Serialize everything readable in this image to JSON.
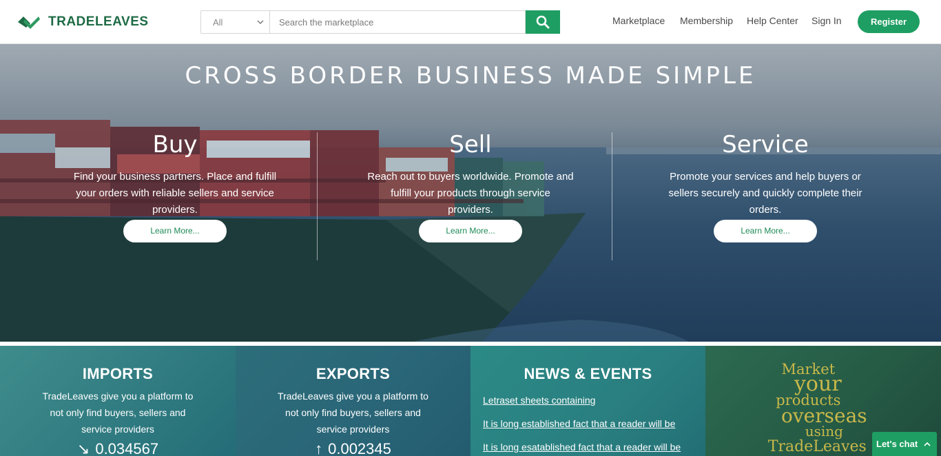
{
  "brand": {
    "name": "TRADELEAVES",
    "color": "#1e6b45",
    "accent": "#1e9e62"
  },
  "search": {
    "category": "All",
    "placeholder": "Search the marketplace"
  },
  "nav": {
    "items": [
      "Marketplace",
      "Membership",
      "Help Center",
      "Sign In"
    ],
    "register_label": "Register"
  },
  "hero": {
    "title": "CROSS BORDER BUSINESS MADE SIMPLE",
    "columns": [
      {
        "heading": "Buy",
        "text": "Find your business partners. Place and fulfill your orders with reliable sellers and service providers.",
        "button": "Learn More..."
      },
      {
        "heading": "Sell",
        "text": "Reach out to buyers worldwide. Promote and fulfill your products through service providers.",
        "button": "Learn More..."
      },
      {
        "heading": "Service",
        "text": "Promote your services and help buyers or sellers securely and quickly complete their orders.",
        "button": "Learn More..."
      }
    ]
  },
  "panels": {
    "imports": {
      "title": "IMPORTS",
      "text": "TradeLeaves give you a platform to not only find buyers, sellers and service providers",
      "counter": "0.034567"
    },
    "exports": {
      "title": "EXPORTS",
      "text": "TradeLeaves give you a platform to not only find buyers, sellers and service providers",
      "counter": "0.002345"
    },
    "news": {
      "title": "NEWS & EVENTS",
      "items": [
        "Letraset sheets containing",
        "It is long established fact that a reader will be",
        "It is long esatablished fact that a reader will be"
      ]
    },
    "promo": {
      "lines": [
        "Market",
        "your",
        "products",
        "overseas",
        "using",
        "TradeLeaves"
      ]
    }
  },
  "chat": {
    "label": "Let's chat"
  }
}
